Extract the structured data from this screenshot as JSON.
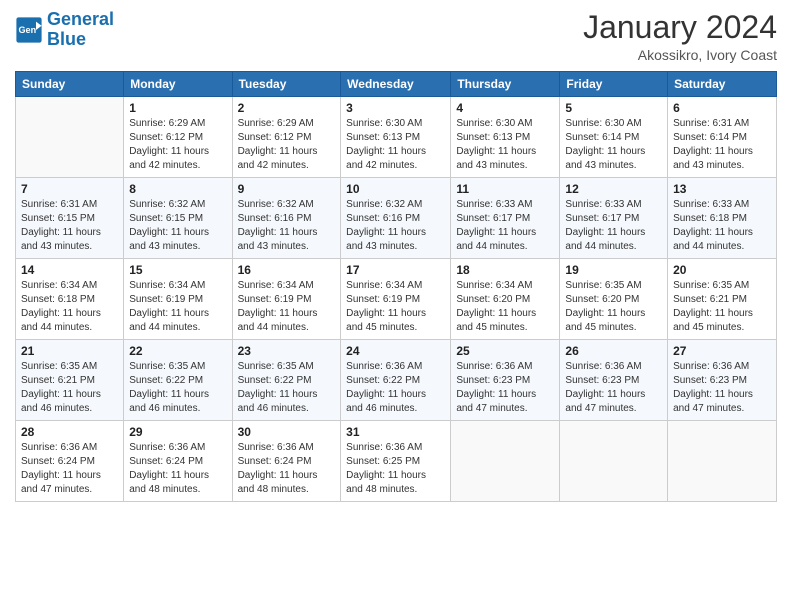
{
  "header": {
    "logo_line1": "General",
    "logo_line2": "Blue",
    "main_title": "January 2024",
    "subtitle": "Akossikro, Ivory Coast"
  },
  "days_of_week": [
    "Sunday",
    "Monday",
    "Tuesday",
    "Wednesday",
    "Thursday",
    "Friday",
    "Saturday"
  ],
  "weeks": [
    [
      {
        "num": "",
        "sunrise": "",
        "sunset": "",
        "daylight": ""
      },
      {
        "num": "1",
        "sunrise": "Sunrise: 6:29 AM",
        "sunset": "Sunset: 6:12 PM",
        "daylight": "Daylight: 11 hours and 42 minutes."
      },
      {
        "num": "2",
        "sunrise": "Sunrise: 6:29 AM",
        "sunset": "Sunset: 6:12 PM",
        "daylight": "Daylight: 11 hours and 42 minutes."
      },
      {
        "num": "3",
        "sunrise": "Sunrise: 6:30 AM",
        "sunset": "Sunset: 6:13 PM",
        "daylight": "Daylight: 11 hours and 42 minutes."
      },
      {
        "num": "4",
        "sunrise": "Sunrise: 6:30 AM",
        "sunset": "Sunset: 6:13 PM",
        "daylight": "Daylight: 11 hours and 43 minutes."
      },
      {
        "num": "5",
        "sunrise": "Sunrise: 6:30 AM",
        "sunset": "Sunset: 6:14 PM",
        "daylight": "Daylight: 11 hours and 43 minutes."
      },
      {
        "num": "6",
        "sunrise": "Sunrise: 6:31 AM",
        "sunset": "Sunset: 6:14 PM",
        "daylight": "Daylight: 11 hours and 43 minutes."
      }
    ],
    [
      {
        "num": "7",
        "sunrise": "Sunrise: 6:31 AM",
        "sunset": "Sunset: 6:15 PM",
        "daylight": "Daylight: 11 hours and 43 minutes."
      },
      {
        "num": "8",
        "sunrise": "Sunrise: 6:32 AM",
        "sunset": "Sunset: 6:15 PM",
        "daylight": "Daylight: 11 hours and 43 minutes."
      },
      {
        "num": "9",
        "sunrise": "Sunrise: 6:32 AM",
        "sunset": "Sunset: 6:16 PM",
        "daylight": "Daylight: 11 hours and 43 minutes."
      },
      {
        "num": "10",
        "sunrise": "Sunrise: 6:32 AM",
        "sunset": "Sunset: 6:16 PM",
        "daylight": "Daylight: 11 hours and 43 minutes."
      },
      {
        "num": "11",
        "sunrise": "Sunrise: 6:33 AM",
        "sunset": "Sunset: 6:17 PM",
        "daylight": "Daylight: 11 hours and 44 minutes."
      },
      {
        "num": "12",
        "sunrise": "Sunrise: 6:33 AM",
        "sunset": "Sunset: 6:17 PM",
        "daylight": "Daylight: 11 hours and 44 minutes."
      },
      {
        "num": "13",
        "sunrise": "Sunrise: 6:33 AM",
        "sunset": "Sunset: 6:18 PM",
        "daylight": "Daylight: 11 hours and 44 minutes."
      }
    ],
    [
      {
        "num": "14",
        "sunrise": "Sunrise: 6:34 AM",
        "sunset": "Sunset: 6:18 PM",
        "daylight": "Daylight: 11 hours and 44 minutes."
      },
      {
        "num": "15",
        "sunrise": "Sunrise: 6:34 AM",
        "sunset": "Sunset: 6:19 PM",
        "daylight": "Daylight: 11 hours and 44 minutes."
      },
      {
        "num": "16",
        "sunrise": "Sunrise: 6:34 AM",
        "sunset": "Sunset: 6:19 PM",
        "daylight": "Daylight: 11 hours and 44 minutes."
      },
      {
        "num": "17",
        "sunrise": "Sunrise: 6:34 AM",
        "sunset": "Sunset: 6:19 PM",
        "daylight": "Daylight: 11 hours and 45 minutes."
      },
      {
        "num": "18",
        "sunrise": "Sunrise: 6:34 AM",
        "sunset": "Sunset: 6:20 PM",
        "daylight": "Daylight: 11 hours and 45 minutes."
      },
      {
        "num": "19",
        "sunrise": "Sunrise: 6:35 AM",
        "sunset": "Sunset: 6:20 PM",
        "daylight": "Daylight: 11 hours and 45 minutes."
      },
      {
        "num": "20",
        "sunrise": "Sunrise: 6:35 AM",
        "sunset": "Sunset: 6:21 PM",
        "daylight": "Daylight: 11 hours and 45 minutes."
      }
    ],
    [
      {
        "num": "21",
        "sunrise": "Sunrise: 6:35 AM",
        "sunset": "Sunset: 6:21 PM",
        "daylight": "Daylight: 11 hours and 46 minutes."
      },
      {
        "num": "22",
        "sunrise": "Sunrise: 6:35 AM",
        "sunset": "Sunset: 6:22 PM",
        "daylight": "Daylight: 11 hours and 46 minutes."
      },
      {
        "num": "23",
        "sunrise": "Sunrise: 6:35 AM",
        "sunset": "Sunset: 6:22 PM",
        "daylight": "Daylight: 11 hours and 46 minutes."
      },
      {
        "num": "24",
        "sunrise": "Sunrise: 6:36 AM",
        "sunset": "Sunset: 6:22 PM",
        "daylight": "Daylight: 11 hours and 46 minutes."
      },
      {
        "num": "25",
        "sunrise": "Sunrise: 6:36 AM",
        "sunset": "Sunset: 6:23 PM",
        "daylight": "Daylight: 11 hours and 47 minutes."
      },
      {
        "num": "26",
        "sunrise": "Sunrise: 6:36 AM",
        "sunset": "Sunset: 6:23 PM",
        "daylight": "Daylight: 11 hours and 47 minutes."
      },
      {
        "num": "27",
        "sunrise": "Sunrise: 6:36 AM",
        "sunset": "Sunset: 6:23 PM",
        "daylight": "Daylight: 11 hours and 47 minutes."
      }
    ],
    [
      {
        "num": "28",
        "sunrise": "Sunrise: 6:36 AM",
        "sunset": "Sunset: 6:24 PM",
        "daylight": "Daylight: 11 hours and 47 minutes."
      },
      {
        "num": "29",
        "sunrise": "Sunrise: 6:36 AM",
        "sunset": "Sunset: 6:24 PM",
        "daylight": "Daylight: 11 hours and 48 minutes."
      },
      {
        "num": "30",
        "sunrise": "Sunrise: 6:36 AM",
        "sunset": "Sunset: 6:24 PM",
        "daylight": "Daylight: 11 hours and 48 minutes."
      },
      {
        "num": "31",
        "sunrise": "Sunrise: 6:36 AM",
        "sunset": "Sunset: 6:25 PM",
        "daylight": "Daylight: 11 hours and 48 minutes."
      },
      {
        "num": "",
        "sunrise": "",
        "sunset": "",
        "daylight": ""
      },
      {
        "num": "",
        "sunrise": "",
        "sunset": "",
        "daylight": ""
      },
      {
        "num": "",
        "sunrise": "",
        "sunset": "",
        "daylight": ""
      }
    ]
  ]
}
